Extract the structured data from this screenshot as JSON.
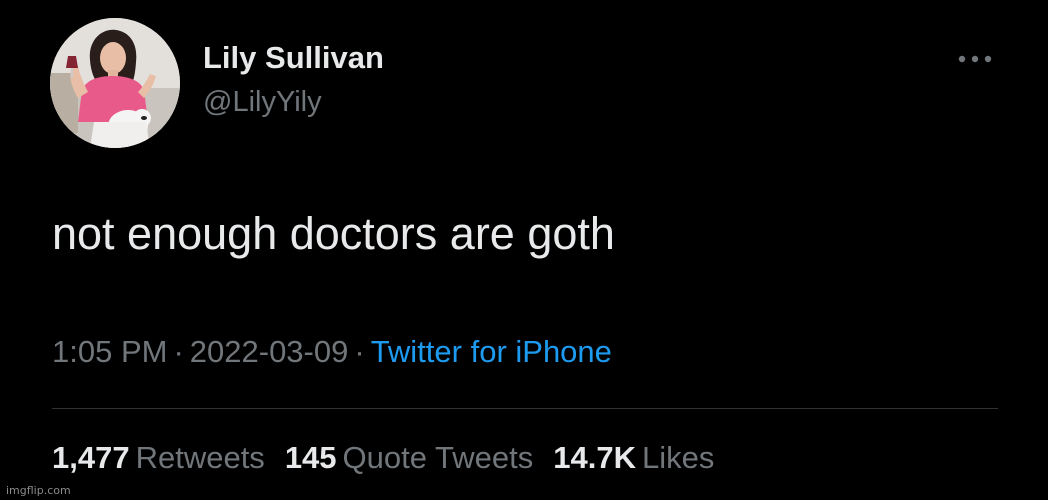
{
  "tweet": {
    "author": {
      "display_name": "Lily Sullivan",
      "handle": "@LilyYily",
      "avatar_icon": "profile-photo"
    },
    "text": "not enough doctors are goth",
    "time": "1:05 PM",
    "date": "2022-03-09",
    "separator": "·",
    "source": "Twitter for iPhone",
    "more_icon": "more-horizontal-icon",
    "stats": {
      "retweets": {
        "count": "1,477",
        "label": "Retweets"
      },
      "quote_tweets": {
        "count": "145",
        "label": "Quote Tweets"
      },
      "likes": {
        "count": "14.7K",
        "label": "Likes"
      }
    }
  },
  "watermark": "imgflip.com",
  "colors": {
    "background": "#000000",
    "primary_text": "#e7e9ea",
    "secondary_text": "#71767b",
    "link": "#1d9bf0",
    "divider": "#2f3336"
  }
}
